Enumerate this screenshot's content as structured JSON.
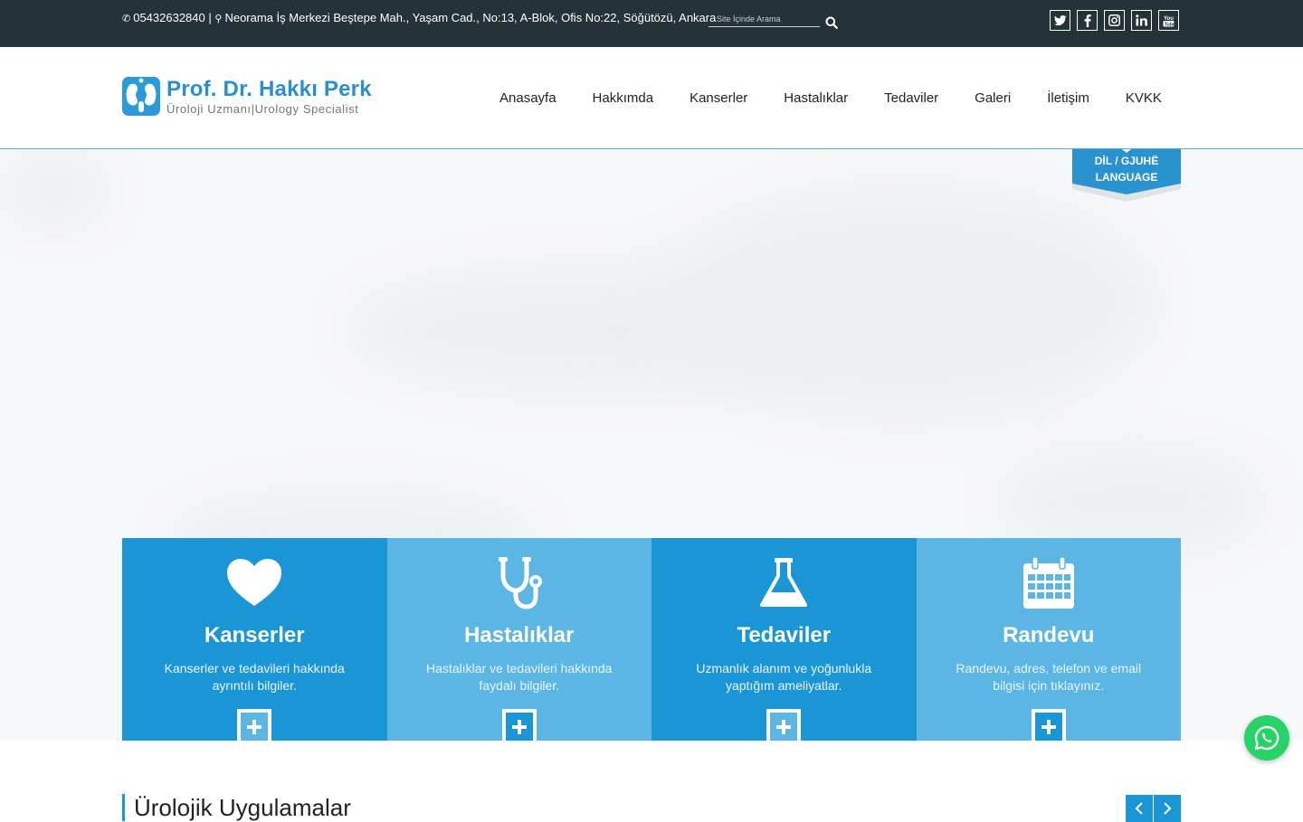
{
  "topbar": {
    "phone": "05432632840",
    "separator": "|",
    "address": "Neorama İş Merkezi Beştepe Mah., Yaşam Cad., No:13, A-Blok, Ofis No:22, Söğütözü, Ankara",
    "search_placeholder": "Site İçinde Arama",
    "socials": [
      {
        "name": "twitter-icon",
        "glyph": "t"
      },
      {
        "name": "facebook-icon",
        "glyph": "f"
      },
      {
        "name": "instagram-icon",
        "glyph": "◎"
      },
      {
        "name": "linkedin-icon",
        "glyph": "in"
      },
      {
        "name": "youtube-icon",
        "glyph": "▶"
      }
    ]
  },
  "header": {
    "logo_title": "Prof. Dr. Hakkı Perk",
    "logo_subtitle": "Üroloji Uzmanı|Urology Specialist",
    "nav": [
      "Anasayfa",
      "Hakkımda",
      "Kanserler",
      "Hastalıklar",
      "Tedaviler",
      "Galeri",
      "İletişim",
      "KVKK"
    ],
    "language_line1": "DİL / GJUHË",
    "language_line2": "LANGUAGE"
  },
  "features": [
    {
      "title": "Kanserler",
      "desc": "Kanserler ve tedavileri hakkında ayrıntılı bilgiler.",
      "icon": "heart-icon"
    },
    {
      "title": "Hastalıklar",
      "desc": "Hastalıklar ve tedavileri hakkında faydalı bilgiler.",
      "icon": "stethoscope-icon"
    },
    {
      "title": "Tedaviler",
      "desc": "Uzmanlık alanım ve yoğunlukla yaptığım ameliyatlar.",
      "icon": "flask-icon"
    },
    {
      "title": "Randevu",
      "desc": "Randevu, adres, telefon ve email bilgisi için tıklayınız.",
      "icon": "calendar-icon"
    }
  ],
  "section": {
    "title": "Ürolojik Uygulamalar"
  },
  "colors": {
    "topbar_bg": "#253238",
    "brand_blue": "#1a96d6",
    "light_blue": "#5bb6e3",
    "whatsapp_green": "#25d366"
  }
}
